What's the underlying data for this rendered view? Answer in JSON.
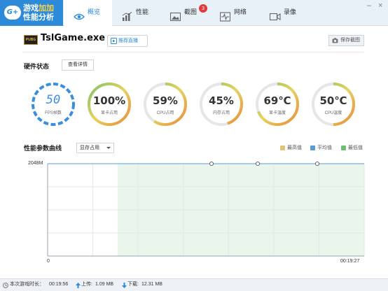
{
  "app": {
    "logo_badge": "G+",
    "logo_line1_a": "游戏",
    "logo_line1_b": "加加",
    "logo_line2": "性能分析"
  },
  "tabs": [
    {
      "label": "概览",
      "icon": "eye-icon",
      "active": true
    },
    {
      "label": "性能",
      "icon": "bar-chart-icon",
      "active": false
    },
    {
      "label": "截图",
      "icon": "image-icon",
      "active": false,
      "badge": "3"
    },
    {
      "label": "网络",
      "icon": "pulse-icon",
      "active": false
    },
    {
      "label": "录像",
      "icon": "video-icon",
      "active": false
    }
  ],
  "window": {
    "minimize": "–",
    "close": "×"
  },
  "header": {
    "game_logo": "PUBG",
    "game_title": "TslGame.exe",
    "recommend_button": "推荐直播",
    "save_button": "保存截图"
  },
  "hardware": {
    "title": "硬件状态",
    "detail_button": "查看详情",
    "gauges": [
      {
        "value": "50",
        "label": "FPS帧数",
        "fill": 1.0,
        "kind": "fps"
      },
      {
        "value": "100%",
        "label": "显卡占用",
        "fill": 1.0,
        "kind": "gradient"
      },
      {
        "value": "59%",
        "label": "CPU占用",
        "fill": 0.59,
        "kind": "gradient"
      },
      {
        "value": "45%",
        "label": "内存占用",
        "fill": 0.45,
        "kind": "gradient"
      },
      {
        "value": "69℃",
        "label": "显卡温度",
        "fill": 0.69,
        "kind": "gradient"
      },
      {
        "value": "50℃",
        "label": "CPU温度",
        "fill": 0.5,
        "kind": "gradient"
      }
    ]
  },
  "curve": {
    "title": "性能参数曲线",
    "selected_metric": "显存占用",
    "legend": [
      {
        "label": "最高值",
        "color": "#e0c27a"
      },
      {
        "label": "平均值",
        "color": "#5b9bd5"
      },
      {
        "label": "最低值",
        "color": "#6fbf73"
      }
    ]
  },
  "chart_data": {
    "type": "area",
    "ytick": "2048M",
    "x_start_label": "0",
    "x_end_label": "00:19:27",
    "series": [
      {
        "name": "最高值",
        "values": [
          2048,
          2048,
          2048
        ]
      },
      {
        "name": "平均值",
        "values": [
          2048,
          2048,
          2048
        ]
      },
      {
        "name": "最低值",
        "values": [
          2048,
          2048,
          2048
        ]
      }
    ],
    "grid": true
  },
  "status": {
    "session_label": "本次游戏时长：",
    "session_time": "00:19:56",
    "upload_label": "上传:",
    "upload_value": "1.09 MB",
    "download_label": "下载:",
    "download_value": "12.31 MB"
  },
  "colors": {
    "accent": "#2d8ad8",
    "area_fill": "#eaf6ec",
    "gauge_start": "#e98a3c",
    "gauge_mid": "#e6d35a",
    "gauge_end": "#7cc36f"
  }
}
